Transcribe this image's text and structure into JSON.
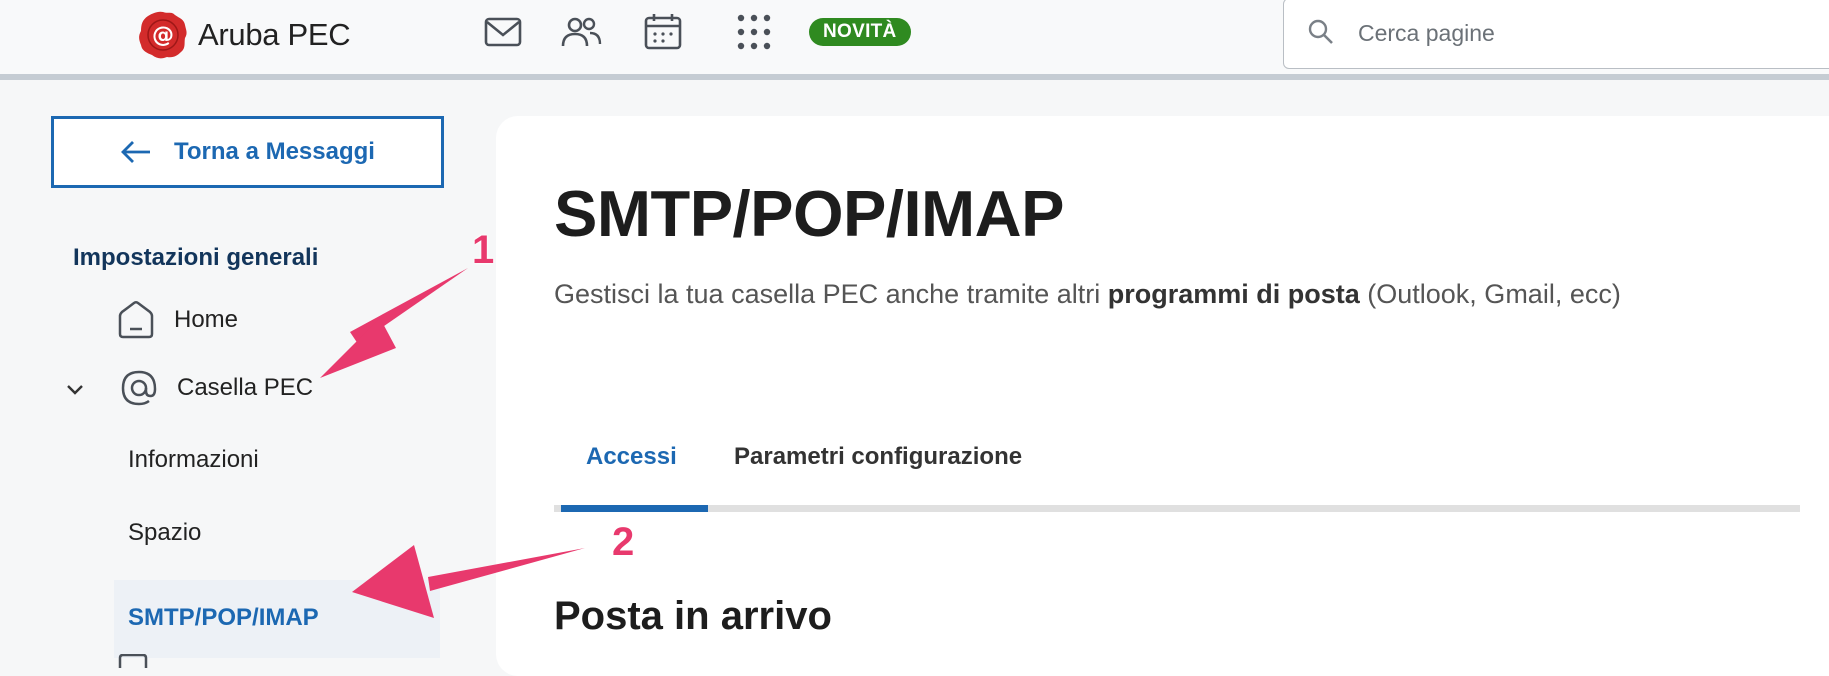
{
  "header": {
    "brand_name": "Aruba PEC",
    "icons": [
      "mail-icon",
      "contacts-icon",
      "calendar-icon",
      "apps-grid-icon"
    ],
    "badge": "NOVITÀ",
    "search": {
      "placeholder": "Cerca pagine",
      "value": ""
    }
  },
  "sidebar": {
    "back_button": "Torna a Messaggi",
    "heading": "Impostazioni generali",
    "items": [
      {
        "label": "Home",
        "icon": "home-icon"
      },
      {
        "label": "Casella PEC",
        "icon": "at-sign-icon",
        "expanded": true
      }
    ],
    "subitems": [
      "Informazioni",
      "Spazio",
      "SMTP/POP/IMAP"
    ],
    "active_subitem": "SMTP/POP/IMAP"
  },
  "main": {
    "title": "SMTP/POP/IMAP",
    "description_prefix": "Gestisci la tua casella PEC anche tramite altri ",
    "description_bold": "programmi di posta",
    "description_suffix": " (Outlook, Gmail, ecc)",
    "tabs": [
      {
        "label": "Accessi",
        "active": true
      },
      {
        "label": "Parametri configurazione",
        "active": false
      }
    ],
    "section_title": "Posta in arrivo"
  },
  "annotations": {
    "marker_1": "1",
    "marker_2": "2"
  },
  "colors": {
    "accent": "#1c68b2",
    "badge": "#2f8a20",
    "annotation": "#e8396d",
    "logo": "#d32b2b"
  }
}
